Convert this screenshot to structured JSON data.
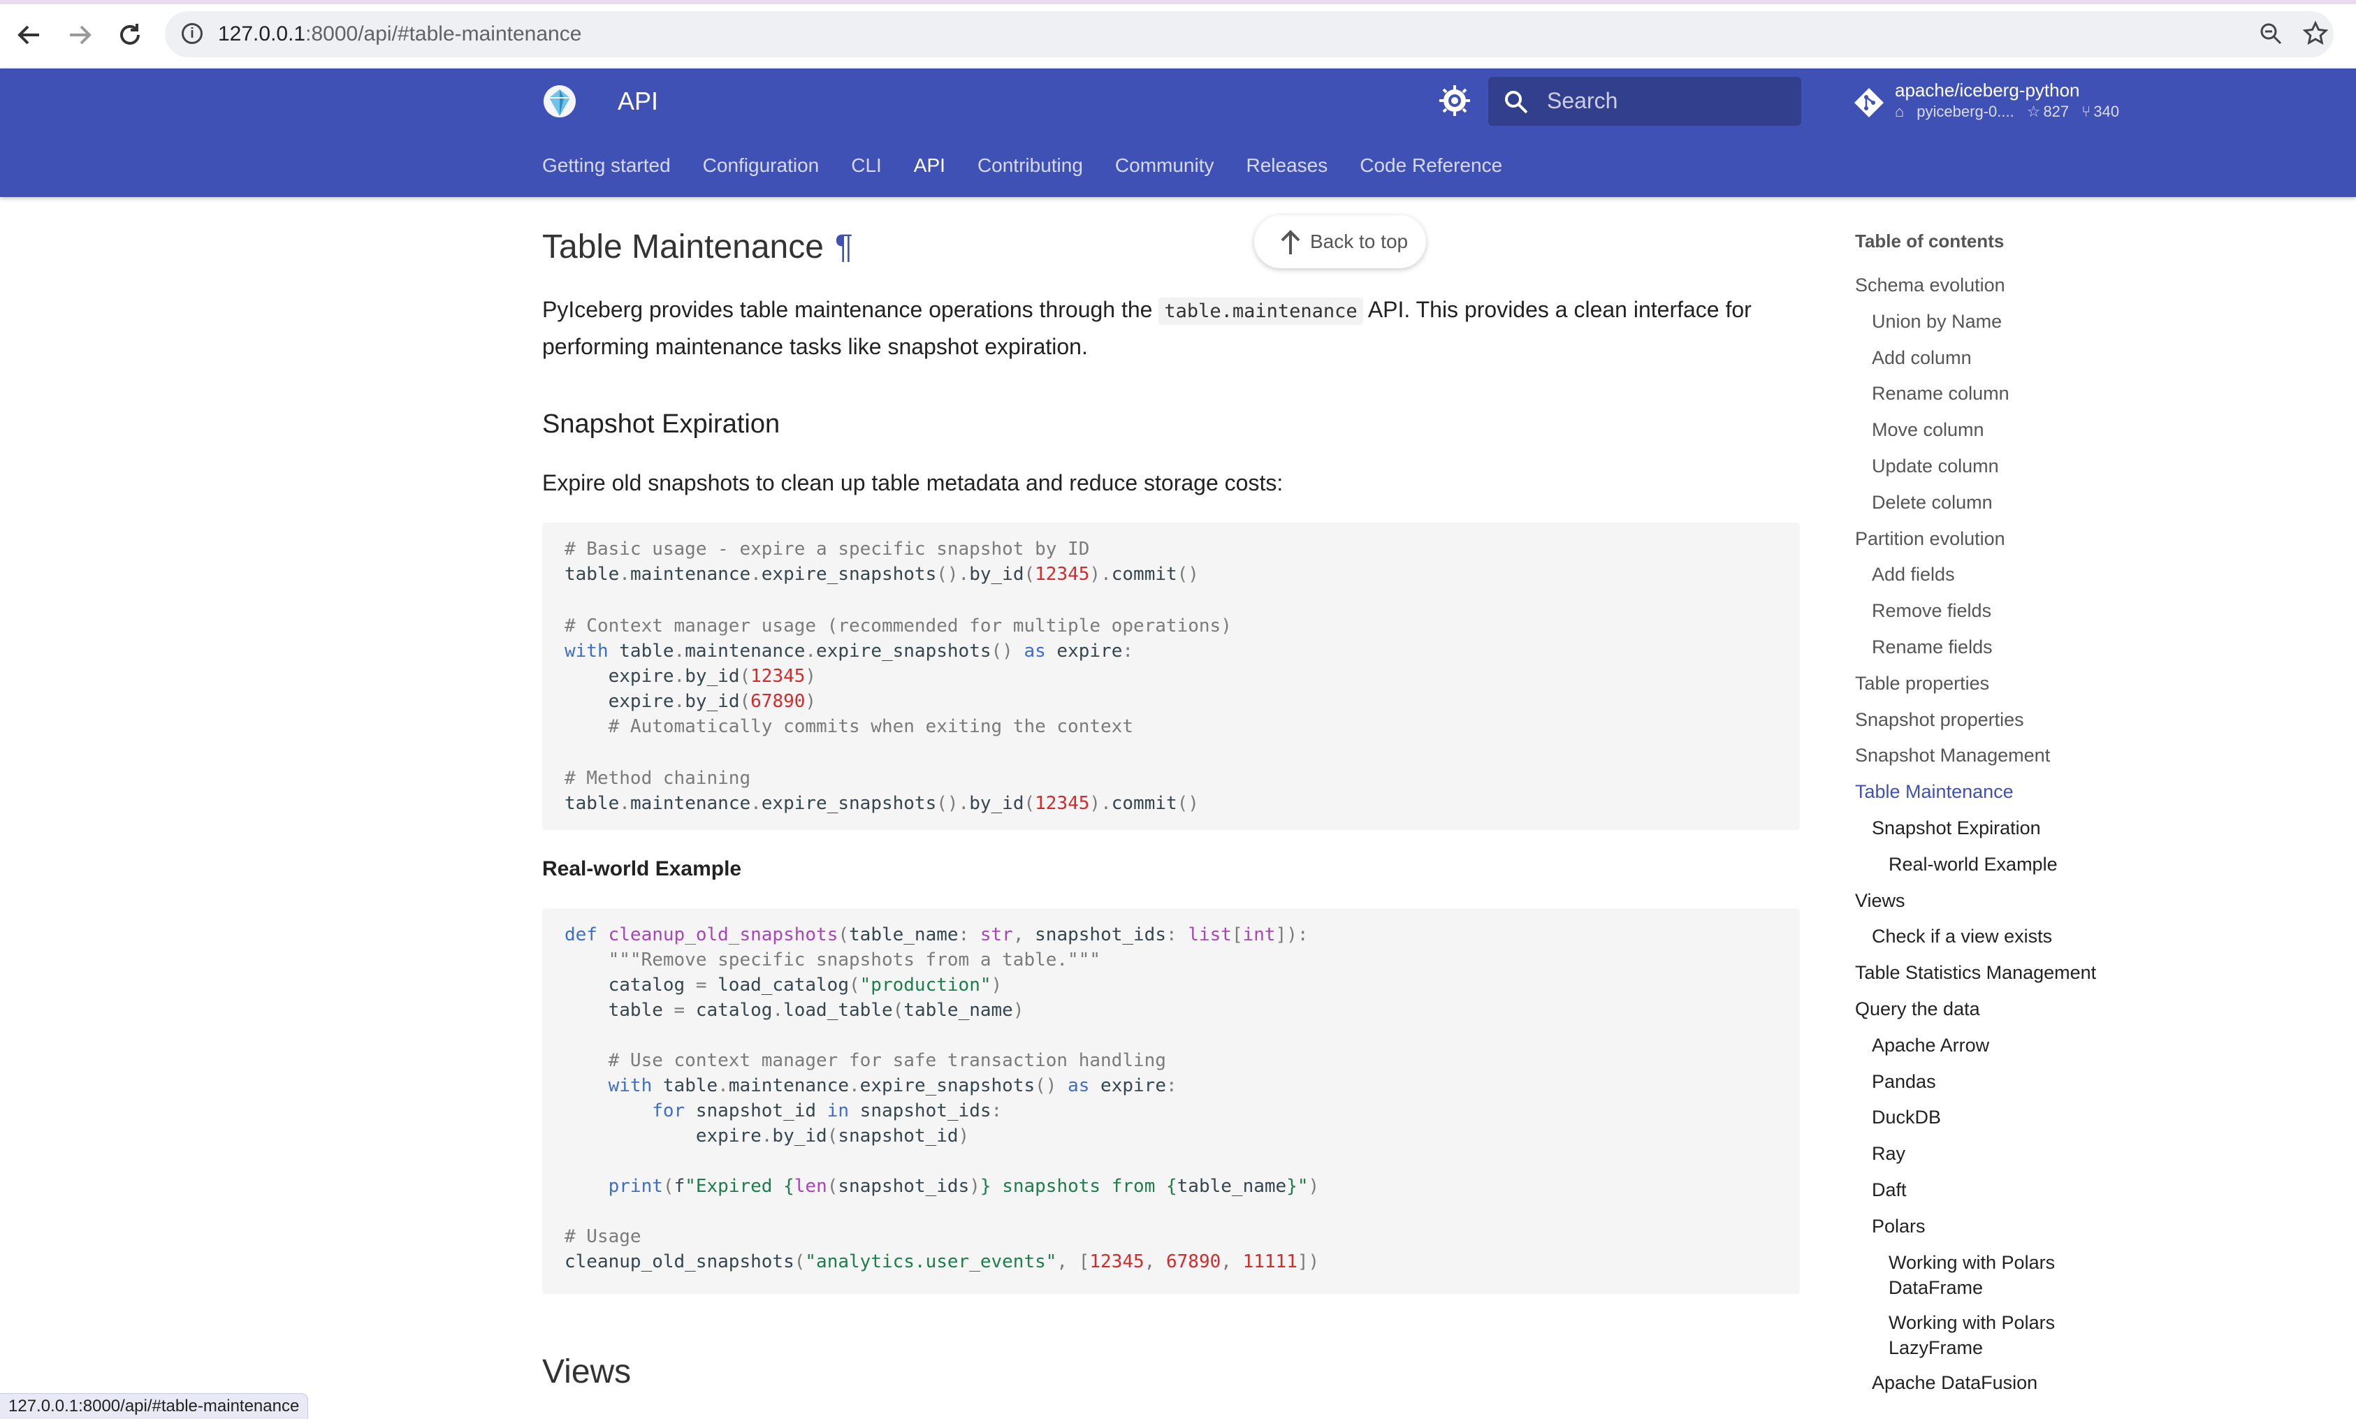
{
  "browser": {
    "url_host": "127.0.0.1",
    "url_path": ":8000/api/#table-maintenance"
  },
  "header": {
    "title": "API",
    "search_placeholder": "Search",
    "repo": {
      "name": "apache/iceberg-python",
      "tag": "pyiceberg-0....",
      "stars": "827",
      "forks": "340"
    },
    "tabs": [
      {
        "label": "Getting started"
      },
      {
        "label": "Configuration"
      },
      {
        "label": "CLI"
      },
      {
        "label": "API",
        "active": true
      },
      {
        "label": "Contributing"
      },
      {
        "label": "Community"
      },
      {
        "label": "Releases"
      },
      {
        "label": "Code Reference"
      }
    ],
    "colors": {
      "primary": "#4051b5"
    }
  },
  "back_to_top": "Back to top",
  "main": {
    "heading": "Table Maintenance",
    "headerlink": "¶",
    "intro_before": "PyIceberg provides table maintenance operations through the ",
    "intro_code": "table.maintenance",
    "intro_after": " API. This provides a clean interface for performing maintenance tasks like snapshot expiration.",
    "snapshot_heading": "Snapshot Expiration",
    "snapshot_text": "Expire old snapshots to clean up table metadata and reduce storage costs:",
    "code1": [
      "# Basic usage - expire a specific snapshot by ID",
      "table.maintenance.expire_snapshots().by_id(12345).commit()",
      "",
      "# Context manager usage (recommended for multiple operations)",
      "with table.maintenance.expire_snapshots() as expire:",
      "    expire.by_id(12345)",
      "    expire.by_id(67890)",
      "    # Automatically commits when exiting the context",
      "",
      "# Method chaining",
      "table.maintenance.expire_snapshots().by_id(12345).commit()"
    ],
    "example_heading": "Real-world Example",
    "code2": [
      "def cleanup_old_snapshots(table_name: str, snapshot_ids: list[int]):",
      "    \"\"\"Remove specific snapshots from a table.\"\"\"",
      "    catalog = load_catalog(\"production\")",
      "    table = catalog.load_table(table_name)",
      "",
      "    # Use context manager for safe transaction handling",
      "    with table.maintenance.expire_snapshots() as expire:",
      "        for snapshot_id in snapshot_ids:",
      "            expire.by_id(snapshot_id)",
      "",
      "    print(f\"Expired {len(snapshot_ids)} snapshots from {table_name}\")",
      "",
      "# Usage",
      "cleanup_old_snapshots(\"analytics.user_events\", [12345, 67890, 11111])"
    ],
    "views_heading": "Views"
  },
  "toc": {
    "title": "Table of contents",
    "items": [
      {
        "label": "Schema evolution",
        "level": 0
      },
      {
        "label": "Union by Name",
        "level": 1
      },
      {
        "label": "Add column",
        "level": 1
      },
      {
        "label": "Rename column",
        "level": 1
      },
      {
        "label": "Move column",
        "level": 1
      },
      {
        "label": "Update column",
        "level": 1
      },
      {
        "label": "Delete column",
        "level": 1
      },
      {
        "label": "Partition evolution",
        "level": 0
      },
      {
        "label": "Add fields",
        "level": 1
      },
      {
        "label": "Remove fields",
        "level": 1
      },
      {
        "label": "Rename fields",
        "level": 1
      },
      {
        "label": "Table properties",
        "level": 0
      },
      {
        "label": "Snapshot properties",
        "level": 0
      },
      {
        "label": "Snapshot Management",
        "level": 0
      },
      {
        "label": "Table Maintenance",
        "level": 0,
        "state": "active"
      },
      {
        "label": "Snapshot Expiration",
        "level": 1,
        "state": "dark"
      },
      {
        "label": "Real-world Example",
        "level": 2,
        "state": "dark"
      },
      {
        "label": "Views",
        "level": 0,
        "state": "dark"
      },
      {
        "label": "Check if a view exists",
        "level": 1,
        "state": "dark"
      },
      {
        "label": "Table Statistics Management",
        "level": 0,
        "state": "dark"
      },
      {
        "label": "Query the data",
        "level": 0,
        "state": "dark"
      },
      {
        "label": "Apache Arrow",
        "level": 1,
        "state": "dark"
      },
      {
        "label": "Pandas",
        "level": 1,
        "state": "dark"
      },
      {
        "label": "DuckDB",
        "level": 1,
        "state": "dark"
      },
      {
        "label": "Ray",
        "level": 1,
        "state": "dark"
      },
      {
        "label": "Daft",
        "level": 1,
        "state": "dark"
      },
      {
        "label": "Polars",
        "level": 1,
        "state": "dark"
      },
      {
        "label": "Working with Polars DataFrame",
        "level": 2,
        "state": "dark",
        "wrap": [
          "Working with Polars",
          "DataFrame"
        ]
      },
      {
        "label": "Working with Polars LazyFrame",
        "level": 2,
        "state": "dark",
        "wrap": [
          "Working with Polars",
          "LazyFrame"
        ]
      },
      {
        "label": "Apache DataFusion",
        "level": 1,
        "state": "dark"
      }
    ]
  },
  "status_bar": "127.0.0.1:8000/api/#table-maintenance"
}
